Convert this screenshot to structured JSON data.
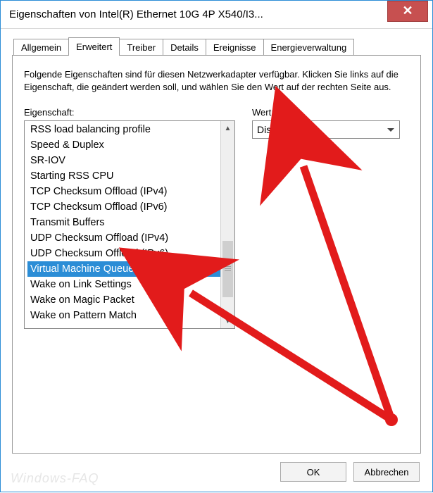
{
  "window": {
    "title": "Eigenschaften von Intel(R) Ethernet 10G 4P X540/I3..."
  },
  "tabs": {
    "items": [
      {
        "label": "Allgemein"
      },
      {
        "label": "Erweitert"
      },
      {
        "label": "Treiber"
      },
      {
        "label": "Details"
      },
      {
        "label": "Ereignisse"
      },
      {
        "label": "Energieverwaltung"
      }
    ],
    "active_index": 1
  },
  "panel": {
    "description": "Folgende Eigenschaften sind für diesen Netzwerkadapter verfügbar. Klicken Sie links auf die Eigenschaft, die geändert werden soll, und wählen Sie den Wert auf der rechten Seite aus.",
    "property_label": "Eigenschaft:",
    "value_label": "Wert:",
    "properties": [
      "RSS load balancing profile",
      "Speed & Duplex",
      "SR-IOV",
      "Starting RSS CPU",
      "TCP Checksum Offload (IPv4)",
      "TCP Checksum Offload (IPv6)",
      "Transmit Buffers",
      "UDP Checksum Offload (IPv4)",
      "UDP Checksum Offload (IPv6)",
      "Virtual Machine Queues",
      "Wake on Link Settings",
      "Wake on Magic Packet",
      "Wake on Pattern Match"
    ],
    "selected_index": 9,
    "value": "Disabled"
  },
  "buttons": {
    "ok": "OK",
    "cancel": "Abbrechen"
  },
  "watermark": "Windows-FAQ"
}
